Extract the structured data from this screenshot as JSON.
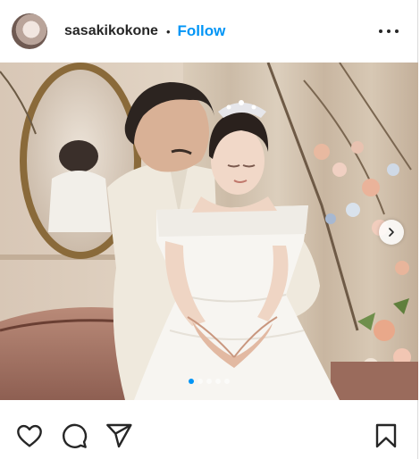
{
  "header": {
    "username": "sasakikokone",
    "separator": "•",
    "follow_label": "Follow"
  },
  "carousel": {
    "slide_count": 5,
    "active_slide": 1
  },
  "icons": {
    "avatar": "profile-photo",
    "more": "more-options-icon",
    "next": "chevron-right-icon",
    "like": "heart-icon",
    "comment": "comment-bubble-icon",
    "share": "paper-plane-icon",
    "save": "bookmark-icon"
  },
  "colors": {
    "accent": "#0095f6",
    "text": "#262626",
    "border": "#dbdbdb"
  }
}
